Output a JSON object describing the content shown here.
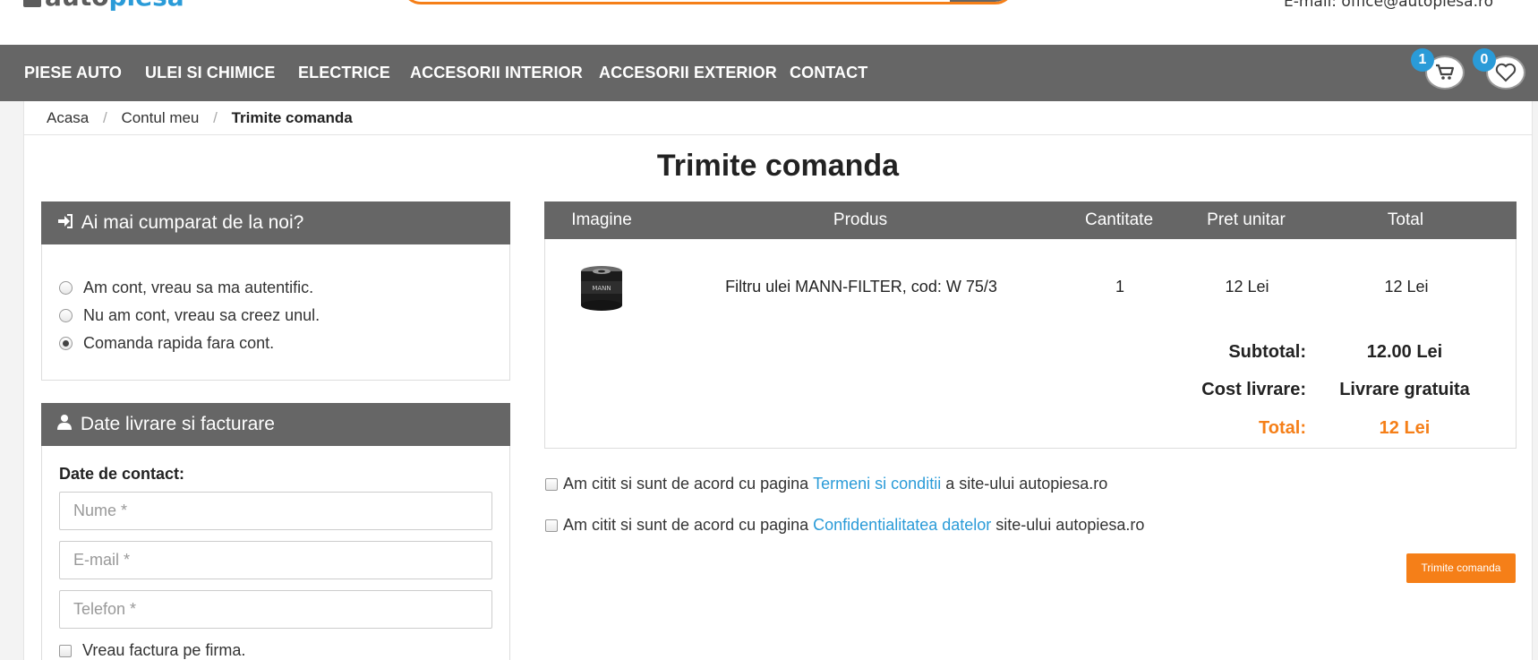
{
  "header": {
    "logo_part1": "auto",
    "logo_part2": "piesa",
    "email": "E-mail: office@autopiesa.ro"
  },
  "nav": {
    "items": [
      {
        "label": "PIESE AUTO"
      },
      {
        "label": "ULEI SI CHIMICE"
      },
      {
        "label": "ELECTRICE"
      },
      {
        "label": "ACCESORII INTERIOR"
      },
      {
        "label": "ACCESORII EXTERIOR"
      },
      {
        "label": "CONTACT"
      }
    ],
    "cart_count": "1",
    "wishlist_count": "0",
    "accent_color": "#2a9bd8"
  },
  "breadcrumb": {
    "items": [
      "Acasa",
      "Contul meu",
      "Trimite comanda"
    ]
  },
  "page_title": "Trimite comanda",
  "login_panel": {
    "title": "Ai mai cumparat de la noi?",
    "options": [
      {
        "label": "Am cont, vreau sa ma autentific.",
        "checked": false
      },
      {
        "label": "Nu am cont, vreau sa creez unul.",
        "checked": false
      },
      {
        "label": "Comanda rapida fara cont.",
        "checked": true
      }
    ]
  },
  "delivery_panel": {
    "title": "Date livrare si facturare",
    "contact_label": "Date de contact:",
    "name_placeholder": "Nume *",
    "email_placeholder": "E-mail *",
    "phone_placeholder": "Telefon *",
    "company_invoice_label": "Vreau factura pe firma."
  },
  "order": {
    "columns": [
      "Imagine",
      "Produs",
      "Cantitate",
      "Pret unitar",
      "Total"
    ],
    "rows": [
      {
        "product": "Filtru ulei MANN-FILTER, cod: W 75/3",
        "qty": "1",
        "unit_price": "12 Lei",
        "total": "12 Lei"
      }
    ],
    "subtotal_label": "Subtotal:",
    "subtotal_value": "12.00 Lei",
    "shipping_label": "Cost livrare:",
    "shipping_value": "Livrare gratuita",
    "total_label": "Total:",
    "total_value": "12 Lei"
  },
  "agreements": {
    "terms_prefix": "Am citit si sunt de acord cu pagina ",
    "terms_link": "Termeni si conditii",
    "terms_suffix": " a site-ului autopiesa.ro",
    "privacy_prefix": "Am citit si sunt de acord cu pagina ",
    "privacy_link": "Confidentialitatea datelor",
    "privacy_suffix": " site-ului autopiesa.ro"
  },
  "submit_label": "Trimite comanda",
  "colors": {
    "nav_bg": "#666666",
    "accent_orange": "#f57f18",
    "link_blue": "#2a9bd8"
  }
}
